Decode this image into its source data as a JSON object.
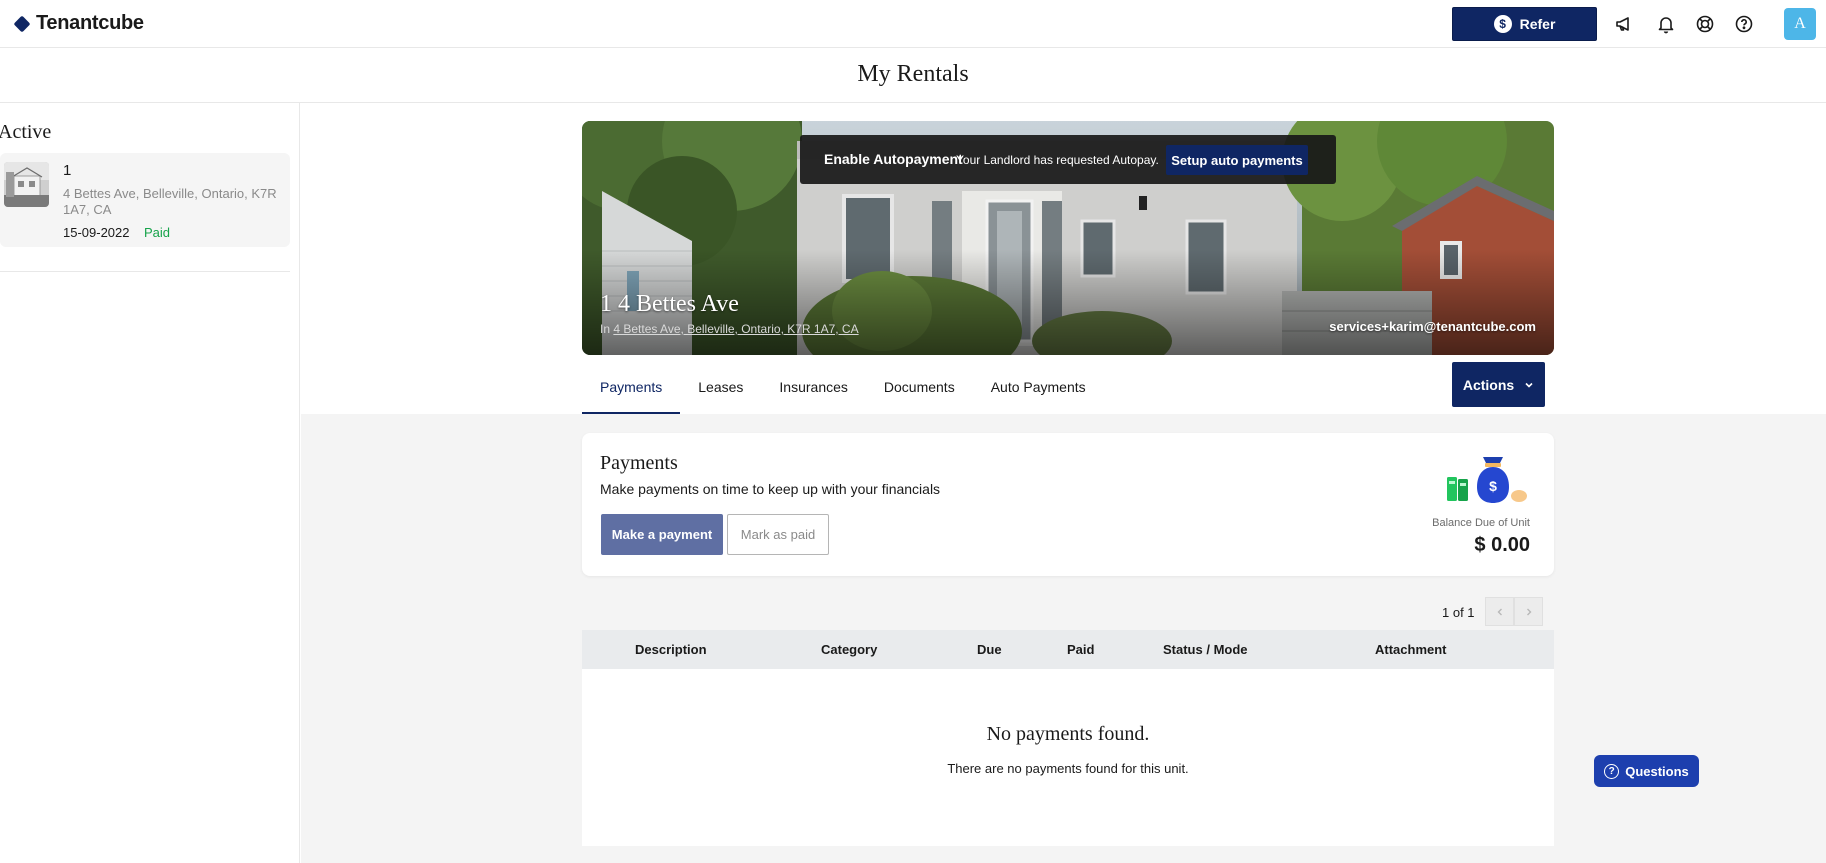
{
  "header": {
    "brand": "Tenantcube",
    "refer_label": "Refer",
    "refer_icon_glyph": "$",
    "avatar_initial": "A",
    "icons": [
      "megaphone-icon",
      "bell-icon",
      "lifebuoy-icon",
      "help-icon"
    ]
  },
  "page": {
    "title": "My Rentals"
  },
  "sidebar": {
    "heading": "Active",
    "rentals": [
      {
        "name": "1",
        "address": "4 Bettes Ave, Belleville, Ontario, K7R 1A7, CA",
        "date": "15-09-2022",
        "status": "Paid"
      }
    ]
  },
  "hero": {
    "banner_title": "Enable Autopayment",
    "banner_text": "Your Landlord has requested Autopay.",
    "banner_button": "Setup auto payments",
    "title": "1 4 Bettes Ave",
    "in_prefix": "In",
    "address_link": "4 Bettes Ave, Belleville, Ontario, K7R 1A7, CA",
    "email": "services+karim@tenantcube.com"
  },
  "tabs": [
    {
      "label": "Payments",
      "active": true
    },
    {
      "label": "Leases",
      "active": false
    },
    {
      "label": "Insurances",
      "active": false
    },
    {
      "label": "Documents",
      "active": false
    },
    {
      "label": "Auto Payments",
      "active": false
    }
  ],
  "actions_label": "Actions",
  "payments": {
    "title": "Payments",
    "subtitle": "Make payments on time to keep up with your financials",
    "make_payment": "Make a payment",
    "mark_paid": "Mark as paid",
    "balance_label": "Balance Due of Unit",
    "balance_value": "$ 0.00"
  },
  "pagination": {
    "text": "1 of 1"
  },
  "table": {
    "columns": [
      "Description",
      "Category",
      "Due",
      "Paid",
      "Status / Mode",
      "Attachment"
    ],
    "empty_title": "No payments found.",
    "empty_text": "There are no payments found for this unit."
  },
  "questions_label": "Questions",
  "colors": {
    "primary": "#0f2663",
    "paid": "#16a34a",
    "avatar": "#4db6e8",
    "questions": "#1d3fae"
  }
}
